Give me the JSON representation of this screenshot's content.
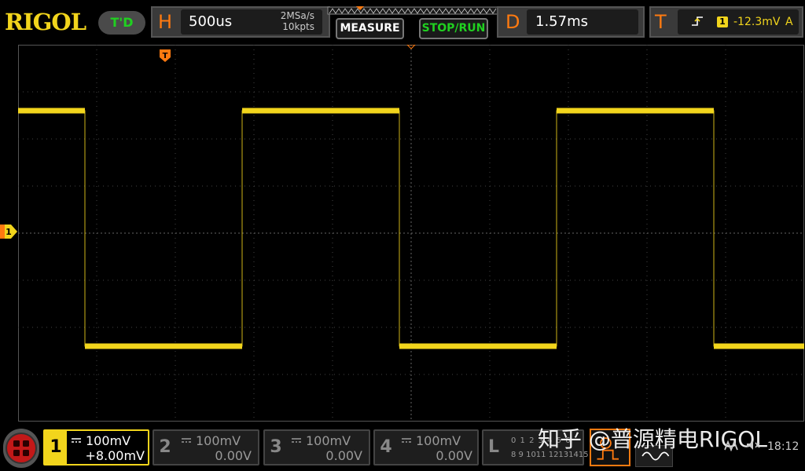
{
  "brand": {
    "logo": "RIGOL"
  },
  "header": {
    "td_label": "T'D",
    "horizontal": {
      "letter": "H",
      "timebase": "500us",
      "sample_rate": "2MSa/s",
      "mem_depth": "10kpts"
    },
    "measure_label": "MEASURE",
    "stoprun_label": "STOP/RUN",
    "delay": {
      "letter": "D",
      "value": "1.57ms"
    },
    "trigger": {
      "letter": "T",
      "edge_icon": "rising-edge-icon",
      "source": "1",
      "level": "-12.3mV",
      "mode": "A"
    }
  },
  "channels": [
    {
      "num": "1",
      "coupling_icon": "dc-coupling-icon",
      "scale": "100mV",
      "offset": "+8.00mV",
      "active": true,
      "color": "#f2d51c"
    },
    {
      "num": "2",
      "coupling_icon": "dc-coupling-icon",
      "scale": "100mV",
      "offset": "0.00V",
      "active": false
    },
    {
      "num": "3",
      "coupling_icon": "dc-coupling-icon",
      "scale": "100mV",
      "offset": "0.00V",
      "active": false
    },
    {
      "num": "4",
      "coupling_icon": "dc-coupling-icon",
      "scale": "100mV",
      "offset": "0.00V",
      "active": false
    }
  ],
  "logic": {
    "letter": "L",
    "row1": "0 1 2 3 4 5 6",
    "row2": "8 9 1011 12131415"
  },
  "ch1_marker": "1",
  "watermark": "知乎 @普源精电RIGOL",
  "status": {
    "clock": "18:12",
    "lan_icon": "lan-icon",
    "speaker_icon": "speaker-muted-icon"
  },
  "colors": {
    "ch1": "#f2d51c",
    "accent": "#ff7a10",
    "run": "#20d020"
  },
  "waveform": {
    "type": "square",
    "period_div": 4,
    "high_div": -2.6,
    "low_div": 2.4,
    "first_edge_div": 0.85,
    "duty": 0.5
  }
}
